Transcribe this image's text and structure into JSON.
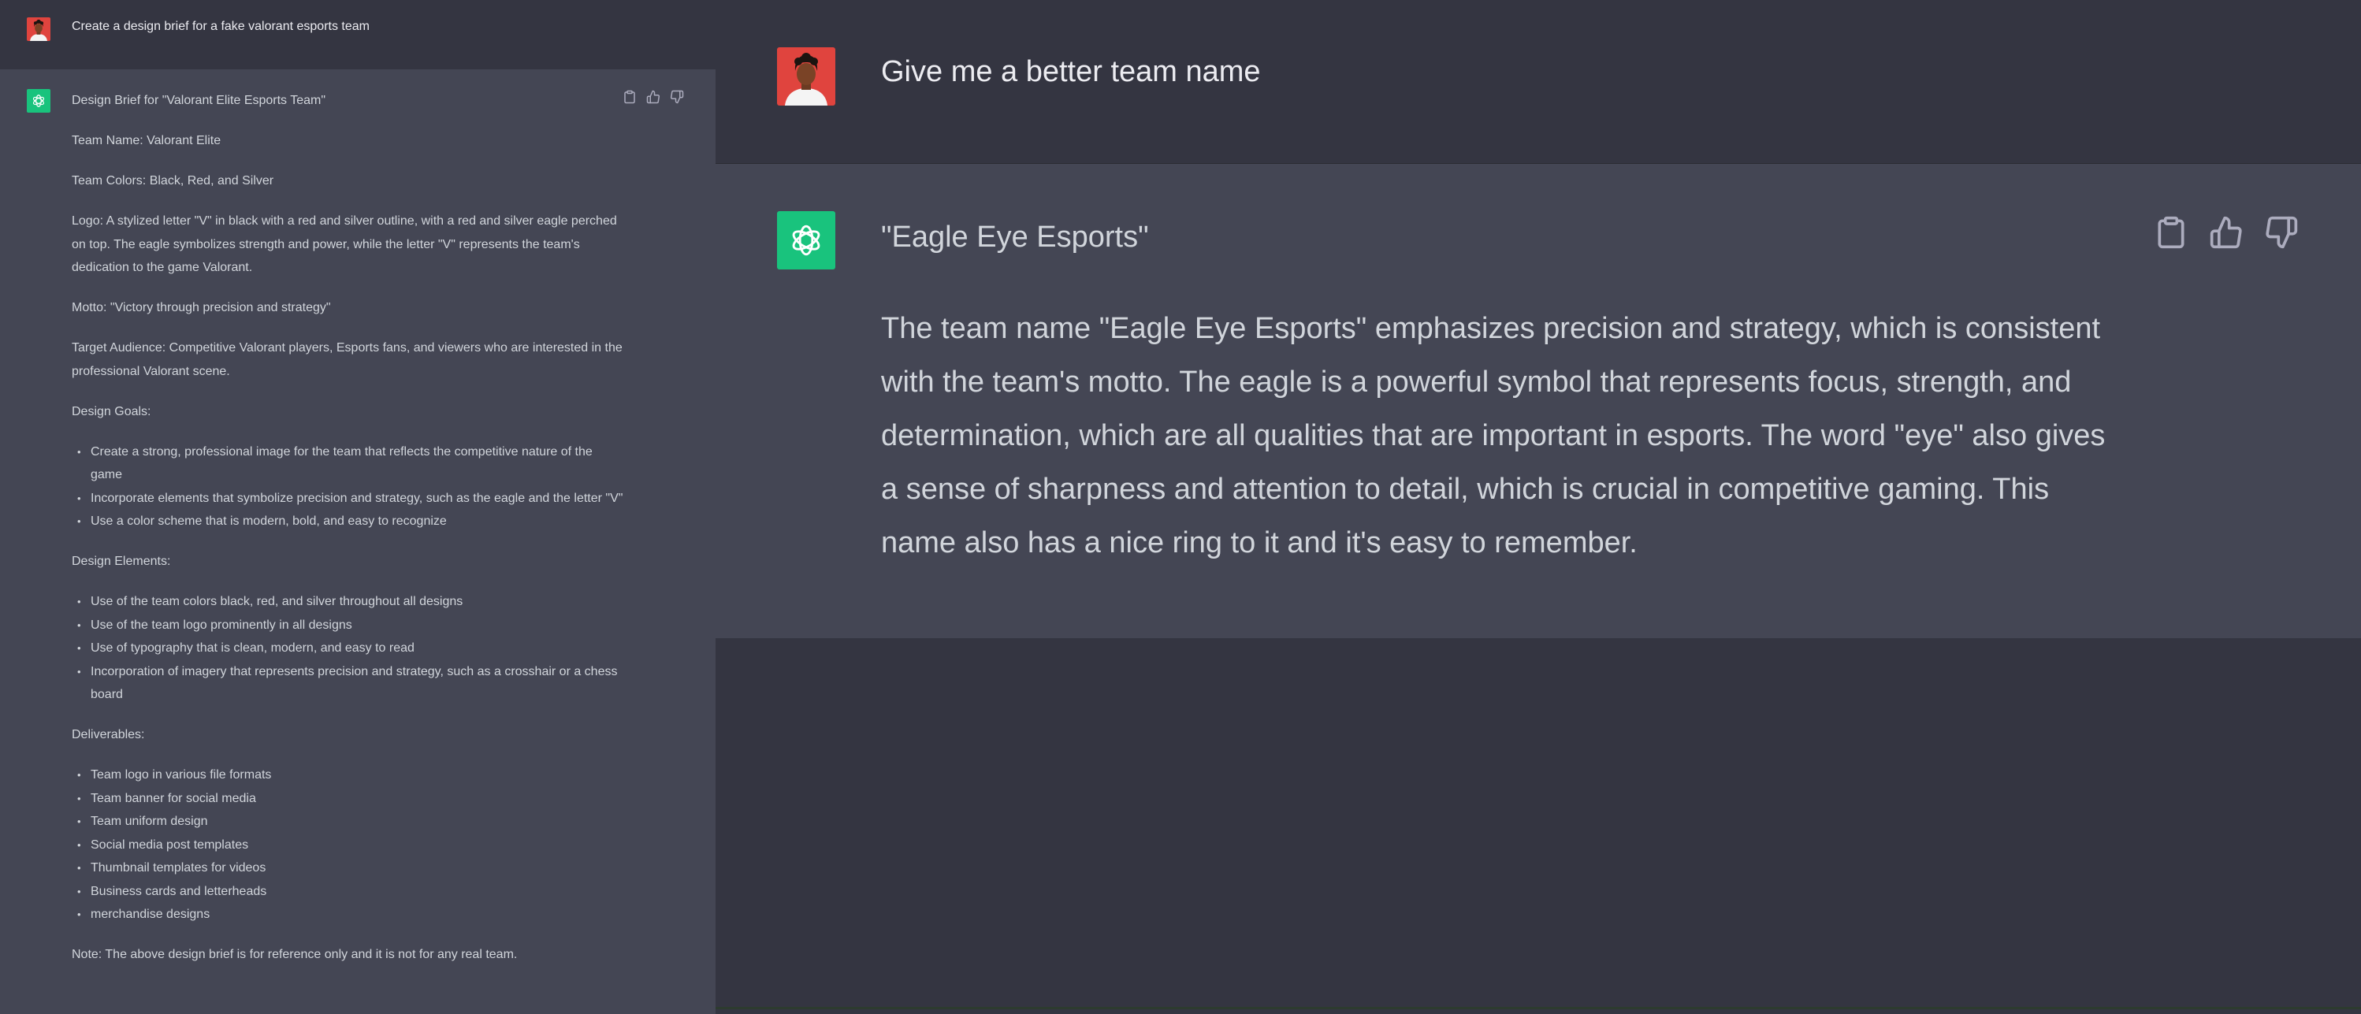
{
  "left_panel": {
    "user_prompt": "Create a design brief for a fake valorant esports team",
    "response": {
      "title": "Design Brief for \"Valorant Elite Esports Team\"",
      "team_name": "Team Name: Valorant Elite",
      "team_colors": "Team Colors: Black, Red, and Silver",
      "logo": "Logo: A stylized letter \"V\" in black with a red and silver outline, with a red and silver eagle perched on top. The eagle symbolizes strength and power, while the letter \"V\" represents the team's dedication to the game Valorant.",
      "motto": "Motto: \"Victory through precision and strategy\"",
      "target_audience": "Target Audience: Competitive Valorant players, Esports fans, and viewers who are interested in the professional Valorant scene.",
      "design_goals_heading": "Design Goals:",
      "design_goals": [
        "Create a strong, professional image for the team that reflects the competitive nature of the game",
        "Incorporate elements that symbolize precision and strategy, such as the eagle and the letter \"V\"",
        "Use a color scheme that is modern, bold, and easy to recognize"
      ],
      "design_elements_heading": "Design Elements:",
      "design_elements": [
        "Use of the team colors black, red, and silver throughout all designs",
        "Use of the team logo prominently in all designs",
        "Use of typography that is clean, modern, and easy to read",
        "Incorporation of imagery that represents precision and strategy, such as a crosshair or a chess board"
      ],
      "deliverables_heading": "Deliverables:",
      "deliverables": [
        "Team logo in various file formats",
        "Team banner for social media",
        "Team uniform design",
        "Social media post templates",
        "Thumbnail templates for videos",
        "Business cards and letterheads",
        "merchandise designs"
      ],
      "note": "Note: The above design brief is for reference only and it is not for any real team."
    }
  },
  "right_panel": {
    "user_prompt": "Give me a better team name",
    "response_title": "\"Eagle Eye Esports\"",
    "response_body": "The team name \"Eagle Eye Esports\" emphasizes precision and strategy, which is consistent with the team's motto. The eagle is a powerful symbol that represents focus, strength, and determination, which are all qualities that are important in esports. The word \"eye\" also gives a sense of sharpness and attention to detail, which is crucial in competitive gaming. This name also has a nice ring to it and it's easy to remember."
  },
  "icons": {
    "copy": "clipboard-icon",
    "like": "thumbs-up-icon",
    "dislike": "thumbs-down-icon",
    "assistant": "openai-logo-icon",
    "user": "user-avatar"
  },
  "colors": {
    "assistant_bg": "#444654",
    "user_bg": "#343541",
    "brand_green": "#19c37d",
    "avatar_red": "#e0443e"
  }
}
